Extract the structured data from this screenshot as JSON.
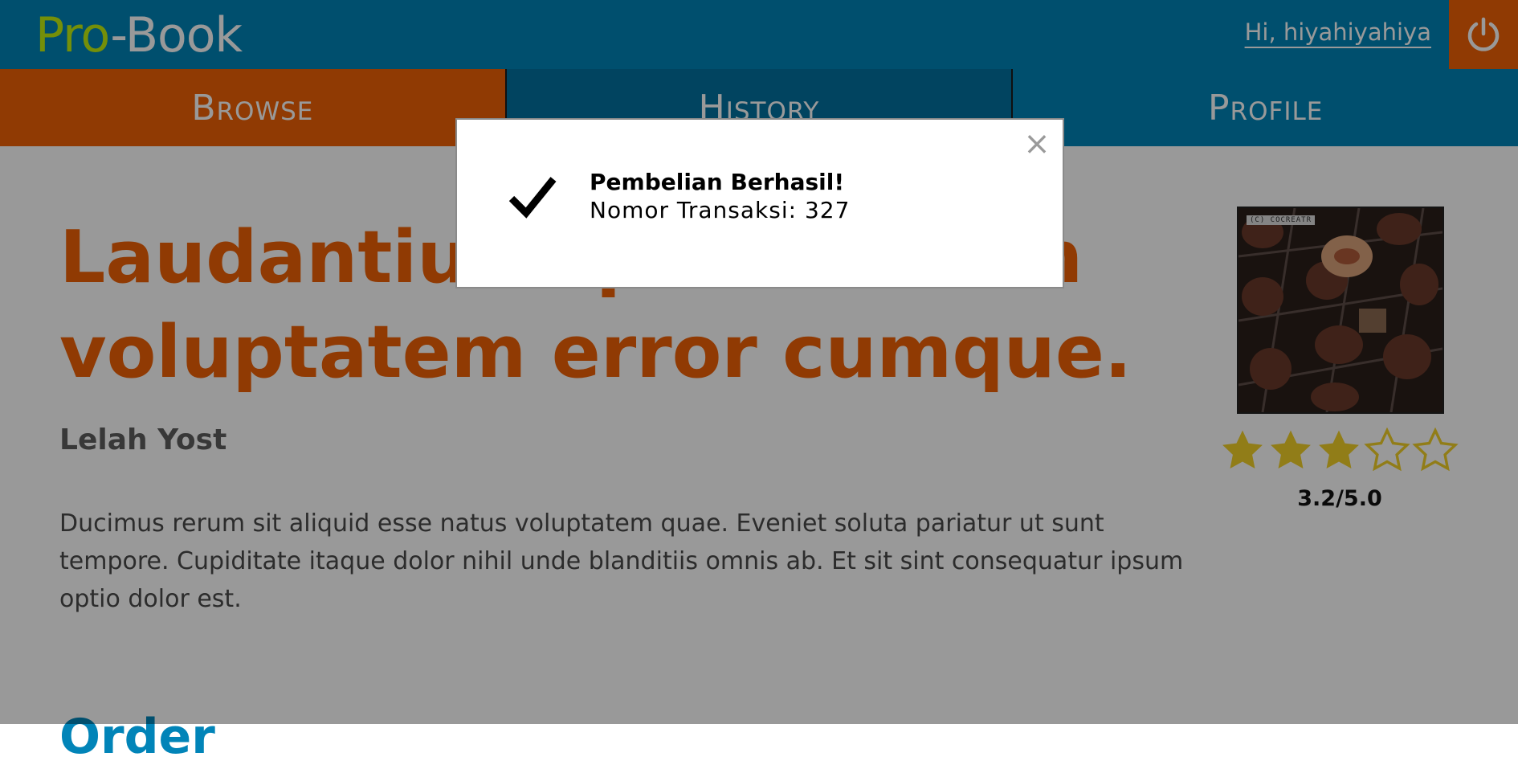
{
  "header": {
    "logo_pro": "Pro",
    "logo_rest": "-Book",
    "greeting": "Hi, hiyahiyahiya",
    "logout_icon": "power-icon"
  },
  "nav": {
    "tabs": [
      {
        "label": "Browse",
        "active": true
      },
      {
        "label": "History",
        "active": false
      },
      {
        "label": "Profile",
        "active": false
      }
    ]
  },
  "book": {
    "title": "Laudantium quo dolorem voluptatem error cumque.",
    "author": "Lelah Yost",
    "description": "Ducimus rerum sit aliquid esse natus voluptatem quae. Eveniet soluta pariatur ut sunt tempore. Cupiditate itaque dolor nihil unde blanditiis omnis ab. Et sit sint consequatur ipsum optio dolor est.",
    "cover_watermark": "(C) COCREATR",
    "rating_value": 3.2,
    "rating_text": "3.2/5.0",
    "stars": [
      true,
      true,
      true,
      false,
      false
    ],
    "next_section_heading": "Order"
  },
  "modal": {
    "title": "Pembelian Berhasil!",
    "transaction": "Nomor Transaksi: 327",
    "check_icon": "checkmark-icon",
    "close_icon": "close-icon",
    "close_label": "×"
  },
  "colors": {
    "primary": "#0184b8",
    "accent": "#f06106",
    "logo_green": "#c2ef10",
    "star_gold": "#f2d028"
  }
}
